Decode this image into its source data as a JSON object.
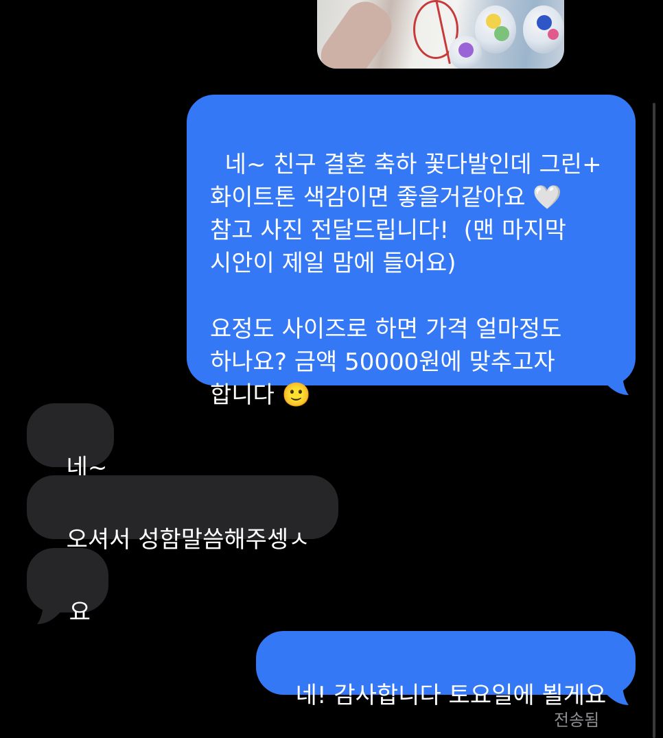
{
  "messages": [
    {
      "id": "m1",
      "direction": "outgoing",
      "type": "image",
      "alt": ""
    },
    {
      "id": "m2",
      "direction": "outgoing",
      "text": "네~ 친구 결혼 축하 꽃다발인데 그린+\n화이트톤 색감이면 좋을거같아요 🤍\n참고 사진 전달드립니다!  (맨 마지막\n시안이 제일 맘에 들어요)\n\n요정도 사이즈로 하면 가격 얼마정도\n하나요? 금액 50000원에 맞추고자\n합니다 🙂"
    },
    {
      "id": "m3",
      "direction": "incoming",
      "text": "네~"
    },
    {
      "id": "m4",
      "direction": "incoming",
      "text": "오셔서 성함말씀해주셍ㅅ"
    },
    {
      "id": "m5",
      "direction": "incoming",
      "text": "요"
    },
    {
      "id": "m6",
      "direction": "outgoing",
      "text": "네! 감사합니다 토요일에 뵐게요"
    }
  ],
  "delivery_status": "전송됨",
  "colors": {
    "outgoing_bubble": "#3478f6",
    "incoming_bubble": "#262628",
    "background": "#000000",
    "status": "#8e8e93"
  }
}
